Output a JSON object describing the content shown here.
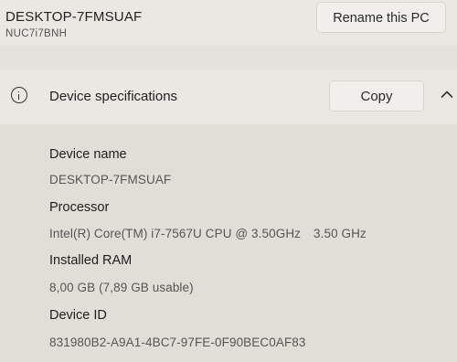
{
  "pc": {
    "name": "DESKTOP-7FMSUAF",
    "model": "NUC7i7BNH",
    "rename_label": "Rename this PC"
  },
  "device_specifications": {
    "title": "Device specifications",
    "copy_label": "Copy",
    "icons": {
      "info": "info-circle-icon",
      "collapse": "chevron-up-icon"
    },
    "rows": [
      {
        "label": "Device name",
        "value": "DESKTOP-7FMSUAF"
      },
      {
        "label": "Processor",
        "value": "Intel(R) Core(TM) i7-7567U CPU @ 3.50GHz",
        "extra": "3.50 GHz"
      },
      {
        "label": "Installed RAM",
        "value": "8,00 GB (7,89 GB usable)"
      },
      {
        "label": "Device ID",
        "value": "831980B2-A9A1-4BC7-97FE-0F90BEC0AF83"
      }
    ]
  }
}
